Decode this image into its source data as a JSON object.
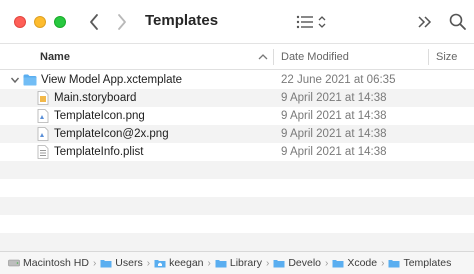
{
  "window": {
    "title": "Templates"
  },
  "toolbar": {
    "back_icon": "chevron-left-icon",
    "forward_icon": "chevron-right-icon",
    "view_icon": "list-view-icon",
    "more_icon": "double-chevron-right-icon",
    "search_icon": "magnifying-glass-icon"
  },
  "columns": {
    "name": "Name",
    "date_modified": "Date Modified",
    "size": "Size"
  },
  "files": [
    {
      "name": "View Model App.xctemplate",
      "date": "22 June 2021 at 06:35",
      "icon": "folder-icon",
      "depth": 0,
      "expanded": true
    },
    {
      "name": "Main.storyboard",
      "date": "9 April 2021 at 14:38",
      "icon": "storyboard-file-icon",
      "depth": 1
    },
    {
      "name": "TemplateIcon.png",
      "date": "9 April 2021 at 14:38",
      "icon": "image-file-icon",
      "depth": 1
    },
    {
      "name": "TemplateIcon@2x.png",
      "date": "9 April 2021 at 14:38",
      "icon": "image-file-icon",
      "depth": 1
    },
    {
      "name": "TemplateInfo.plist",
      "date": "9 April 2021 at 14:38",
      "icon": "plist-file-icon",
      "depth": 1
    }
  ],
  "path_bar": [
    {
      "label": "Macintosh HD",
      "icon": "hard-drive-icon"
    },
    {
      "label": "Users",
      "icon": "folder-icon"
    },
    {
      "label": "keegan",
      "icon": "home-folder-icon"
    },
    {
      "label": "Library",
      "icon": "folder-icon"
    },
    {
      "label": "Develo",
      "icon": "folder-icon"
    },
    {
      "label": "Xcode",
      "icon": "folder-icon"
    },
    {
      "label": "Templates",
      "icon": "folder-icon"
    }
  ],
  "colors": {
    "folder_blue": "#5aaef0",
    "close": "#fe5f57",
    "minimize": "#febc2e",
    "zoom": "#28c840"
  }
}
